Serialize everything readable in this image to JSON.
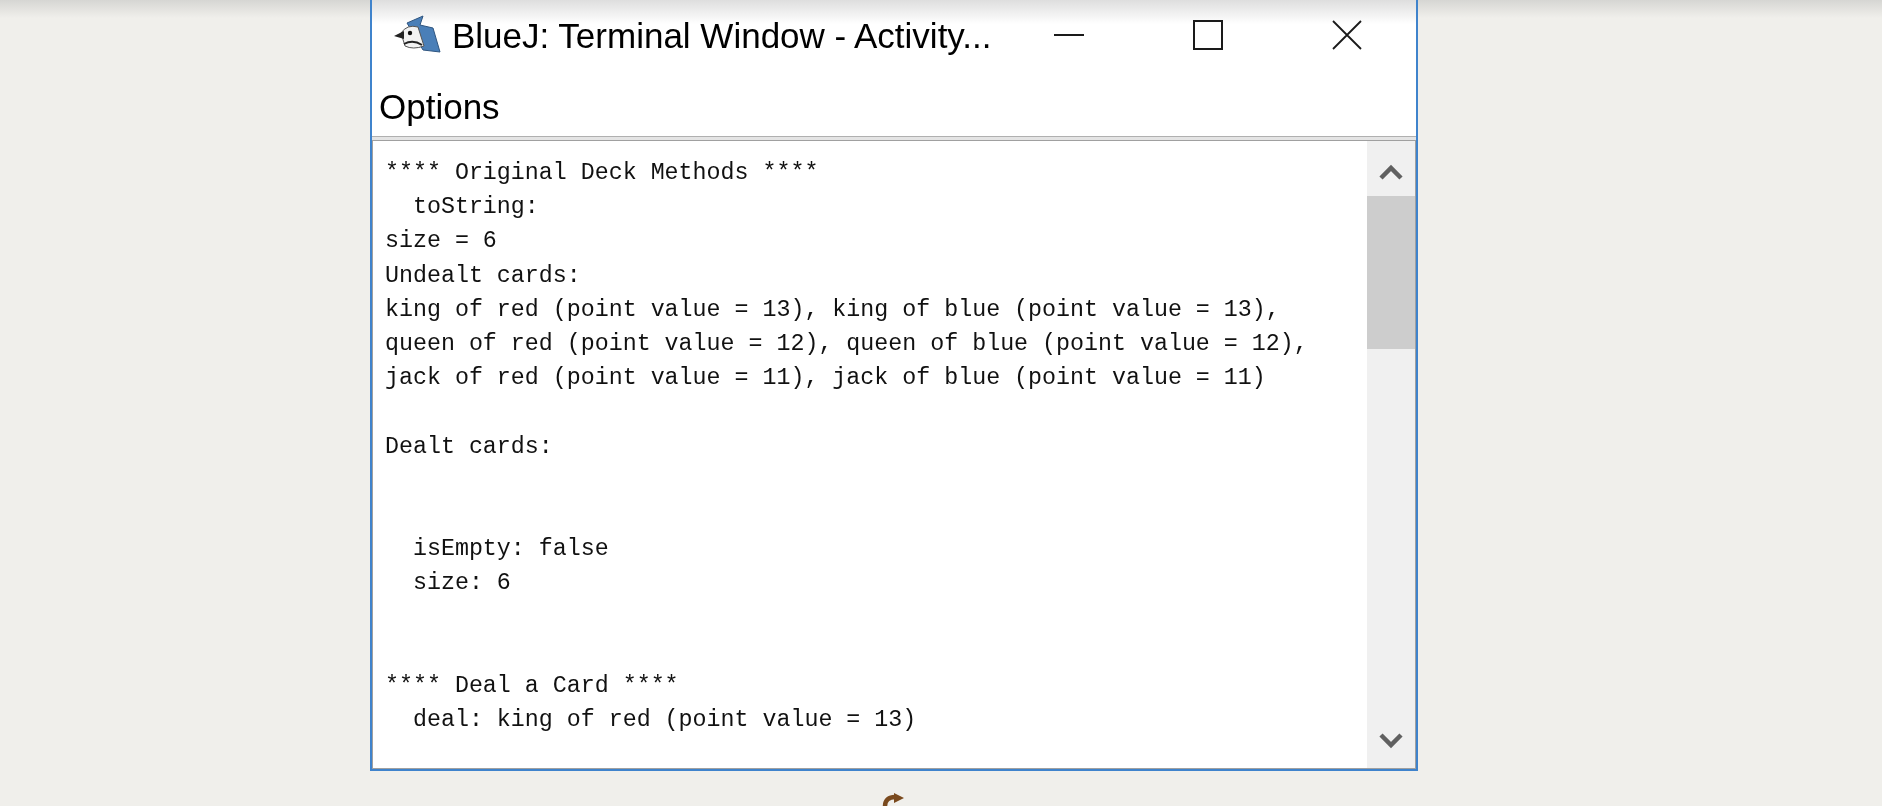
{
  "window": {
    "title": "BlueJ: Terminal Window - Activity..."
  },
  "menu_bar": {
    "items": [
      "Options"
    ]
  },
  "terminal": {
    "lines": [
      {
        "kind": "text",
        "text": "**** Original Deck Methods ****"
      },
      {
        "kind": "text",
        "text": "  toString:"
      },
      {
        "kind": "text",
        "text": "size = 6"
      },
      {
        "kind": "text",
        "text": "Undealt cards:"
      },
      {
        "kind": "text",
        "text": "king of red (point value = 13), king of blue (point value = 13),"
      },
      {
        "kind": "text",
        "text": "queen of red (point value = 12), queen of blue (point value = 12),"
      },
      {
        "kind": "text",
        "text": "jack of red (point value = 11), jack of blue (point value = 11)"
      },
      {
        "kind": "blank"
      },
      {
        "kind": "text",
        "text": "Dealt cards:"
      },
      {
        "kind": "blank"
      },
      {
        "kind": "blank"
      },
      {
        "kind": "text",
        "text": "  isEmpty: false"
      },
      {
        "kind": "text",
        "text": "  size: 6"
      },
      {
        "kind": "blank"
      },
      {
        "kind": "blank"
      },
      {
        "kind": "text",
        "text": "**** Deal a Card ****"
      },
      {
        "kind": "text",
        "text": "  deal: king of red (point value = 13)"
      }
    ]
  }
}
